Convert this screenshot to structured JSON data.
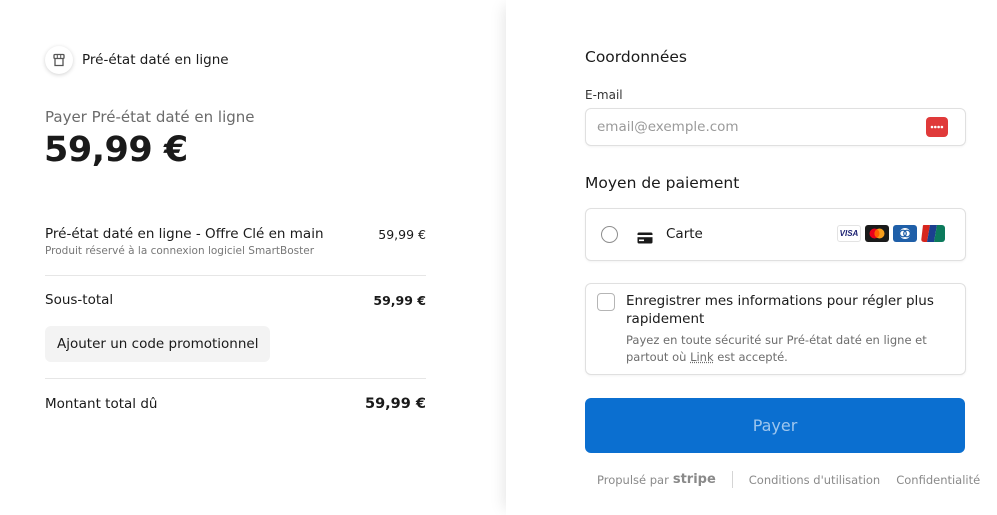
{
  "merchant": {
    "name": "Pré-état daté en ligne",
    "logo_icon": "storefront-icon"
  },
  "summary": {
    "pay_label": "Payer Pré-état daté en ligne",
    "amount": "59,99 €",
    "item": {
      "name": "Pré-état daté en ligne - Offre Clé en main",
      "description": "Produit réservé à la connexion logiciel SmartBoster",
      "price": "59,99 €"
    },
    "subtotal_label": "Sous-total",
    "subtotal_value": "59,99 €",
    "promo_label": "Ajouter un code promotionnel",
    "total_label": "Montant total dû",
    "total_value": "59,99 €"
  },
  "contact": {
    "title": "Coordonnées",
    "email_label": "E-mail",
    "email_value": "",
    "email_placeholder": "email@exemple.com",
    "link_icon": "link-badge-icon"
  },
  "payment": {
    "title": "Moyen de paiement",
    "card_label": "Carte",
    "brands": [
      "visa",
      "mastercard",
      "diners",
      "unionpay"
    ],
    "brand_visa_text": "VISA"
  },
  "save_info": {
    "title": "Enregistrer mes informations pour régler plus rapidement",
    "desc_before": "Payez en toute sécurité sur Pré-état daté en ligne et partout où ",
    "desc_link": "Link",
    "desc_after": " est accepté."
  },
  "pay_button": "Payer",
  "footer": {
    "powered_by": "Propulsé par",
    "stripe": "stripe",
    "terms": "Conditions d'utilisation",
    "privacy": "Confidentialité"
  },
  "colors": {
    "pay_button_bg": "#0b6fd0",
    "pay_button_text": "#9ec6ee",
    "link_badge": "#e03a3a"
  }
}
